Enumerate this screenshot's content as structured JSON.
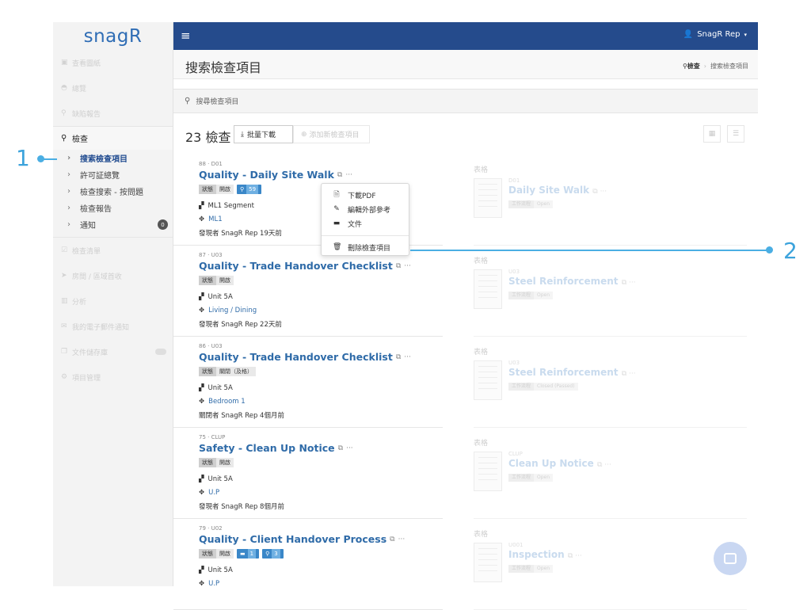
{
  "app": {
    "logo": "snagR"
  },
  "topbar": {
    "user_label": "SnagR Rep"
  },
  "sidebar": {
    "top_items": [
      {
        "icon": "image-icon",
        "label": "查看圖紙"
      },
      {
        "icon": "dashboard-icon",
        "label": "總覽"
      },
      {
        "icon": "pin-icon",
        "label": "缺陷報告"
      }
    ],
    "section": {
      "icon": "search-icon",
      "label": "檢查"
    },
    "sub_items": [
      {
        "label": "搜索檢查項目",
        "active": true
      },
      {
        "label": "許可証總覽"
      },
      {
        "label": "檢查搜索 - 按問題"
      },
      {
        "label": "檢查報告"
      },
      {
        "label": "通知",
        "badge": "0"
      }
    ],
    "bottom_items": [
      {
        "icon": "checklist-icon",
        "label": "檢查清單"
      },
      {
        "icon": "send-icon",
        "label": "房間 / 區域首收"
      },
      {
        "icon": "chart-icon",
        "label": "分析"
      },
      {
        "icon": "mail-icon",
        "label": "我的電子郵件通知"
      },
      {
        "icon": "copy-icon",
        "label": "文件儲存庫"
      },
      {
        "icon": "gears-icon",
        "label": "項目管理"
      }
    ]
  },
  "page": {
    "title": "搜索檢查項目",
    "breadcrumb_root": "檢查",
    "breadcrumb_current": "搜索檢查項目"
  },
  "search": {
    "placeholder": "搜尋檢查項目"
  },
  "toolbar": {
    "count": "23 檢查",
    "bulk_label": "批量下載",
    "add_label": "添加新檢查項目"
  },
  "inspections": [
    {
      "ref": "88 · D01",
      "title": "Quality - Daily Site Walk",
      "status_key": "狀態",
      "status_value": "開啟",
      "pin_count": "59",
      "location": "ML1 Segment",
      "area": "ML1",
      "found": "發現者 SnagR Rep 19天前"
    },
    {
      "ref": "87 · U03",
      "title": "Quality - Trade Handover Checklist",
      "status_key": "狀態",
      "status_value": "開啟",
      "location": "Unit 5A",
      "area": "Living / Dining",
      "found": "發現者 SnagR Rep 22天前"
    },
    {
      "ref": "86 · U03",
      "title": "Quality - Trade Handover Checklist",
      "status_key": "狀態",
      "status_value": "關閉（及格）",
      "location": "Unit 5A",
      "area": "Bedroom 1",
      "found": "關閉者 SnagR Rep 4個月前"
    },
    {
      "ref": "75 · CLUP",
      "title": "Safety - Clean Up Notice",
      "status_key": "狀態",
      "status_value": "開啟",
      "location": "Unit 5A",
      "area": "U.P",
      "found": "發現者 SnagR Rep 8個月前"
    },
    {
      "ref": "79 · U02",
      "title": "Quality - Client Handover Process",
      "status_key": "狀態",
      "status_value": "開啟",
      "folder_count": "1",
      "pin_count": "3",
      "location": "Unit 5A",
      "area": "U.P",
      "found": ""
    }
  ],
  "forms": [
    {
      "label": "表格",
      "ref": "D01",
      "title": "Daily Site Walk",
      "tag_key": "工作流程",
      "tag_value": "Open"
    },
    {
      "label": "表格",
      "ref": "U03",
      "title": "Steel Reinforcement",
      "tag_key": "工作流程",
      "tag_value": "Open"
    },
    {
      "label": "表格",
      "ref": "U03",
      "title": "Steel Reinforcement",
      "tag_key": "工作流程",
      "tag_value": "Closed (Passed)"
    },
    {
      "label": "表格",
      "ref": "CLUP",
      "title": "Clean Up Notice",
      "tag_key": "工作流程",
      "tag_value": "Open"
    },
    {
      "label": "表格",
      "ref": "U001",
      "title": "Inspection",
      "tag_key": "工作流程",
      "tag_value": "Open"
    }
  ],
  "dropdown": {
    "items": [
      {
        "icon": "pdf-icon",
        "label": "下載PDF"
      },
      {
        "icon": "pencil-icon",
        "label": "編輯外部參考"
      },
      {
        "icon": "folder-icon",
        "label": "文件"
      },
      {
        "icon": "trash-icon",
        "label": "刪除檢查項目"
      }
    ]
  },
  "callouts": [
    "1",
    "2"
  ],
  "colors": {
    "topbar": "#254b8c",
    "link": "#2f6ba8",
    "accent": "#3ca3dc"
  }
}
